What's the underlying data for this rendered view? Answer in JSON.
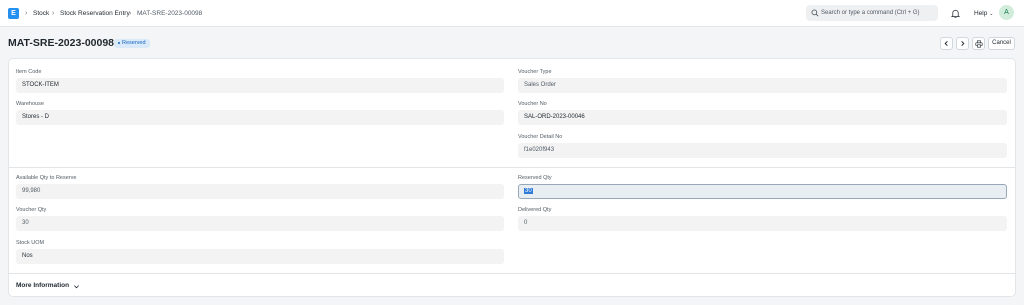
{
  "navbar": {
    "logo_letter": "E",
    "breadcrumbs": [
      "Stock",
      "Stock Reservation Entry",
      "MAT-SRE-2023-00098"
    ],
    "search_placeholder": "Search or type a command (Ctrl + G)",
    "help_label": "Help",
    "avatar_letter": "A"
  },
  "header": {
    "title": "MAT-SRE-2023-00098",
    "status": "Reserved",
    "cancel_label": "Cancel"
  },
  "form": {
    "item_code": {
      "label": "Item Code",
      "value": "STOCK-ITEM"
    },
    "voucher_type": {
      "label": "Voucher Type",
      "value": "Sales Order"
    },
    "warehouse": {
      "label": "Warehouse",
      "value": "Stores - D"
    },
    "voucher_no": {
      "label": "Voucher No",
      "value": "SAL-ORD-2023-00046"
    },
    "voucher_detail_no": {
      "label": "Voucher Detail No",
      "value": "f1e020f943"
    },
    "available_qty": {
      "label": "Available Qty to Reserve",
      "value": "99,980"
    },
    "reserved_qty": {
      "label": "Reserved Qty",
      "value": "30"
    },
    "voucher_qty": {
      "label": "Voucher Qty",
      "value": "30"
    },
    "delivered_qty": {
      "label": "Delivered Qty",
      "value": "0"
    },
    "stock_uom": {
      "label": "Stock UOM",
      "value": "Nos"
    }
  },
  "more_info_label": "More Information",
  "colors": {
    "accent": "#2490ef",
    "badge_bg": "#dbeaf8",
    "badge_text": "#1565c0"
  }
}
